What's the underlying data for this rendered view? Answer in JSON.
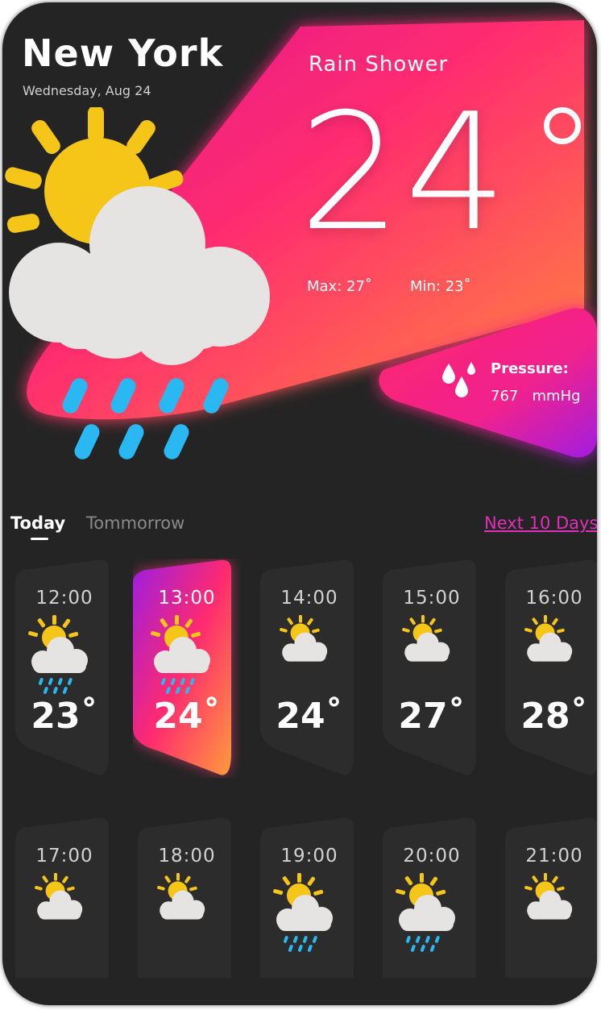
{
  "location": {
    "city": "New York",
    "date": "Wednesday, Aug 24"
  },
  "current": {
    "condition": "Rain Shower",
    "temp": "24",
    "max": "Max: 27˚",
    "min": "Min: 23˚",
    "pressure_label": "Pressure:",
    "pressure_value": "767   mmHg"
  },
  "tabs": {
    "today": "Today",
    "tomorrow": "Tommorrow",
    "next": "Next 10 Days"
  },
  "colors": {
    "background": "#242424",
    "accent_pink": "#ff2d6f",
    "accent_orange": "#ff8a3d",
    "accent_purple": "#a21fe0",
    "link": "#e02fb8"
  },
  "hourly": [
    {
      "time": "12:00",
      "temp": "23˚",
      "icon": "rain-cloud-sun-icon"
    },
    {
      "time": "13:00",
      "temp": "24˚",
      "icon": "rain-cloud-sun-icon"
    },
    {
      "time": "14:00",
      "temp": "24˚",
      "icon": "cloud-sun-icon"
    },
    {
      "time": "15:00",
      "temp": "27˚",
      "icon": "cloud-sun-icon"
    },
    {
      "time": "16:00",
      "temp": "28˚",
      "icon": "cloud-sun-icon"
    },
    {
      "time": "17:00",
      "temp": "",
      "icon": "cloud-sun-icon"
    },
    {
      "time": "18:00",
      "temp": "",
      "icon": "cloud-sun-icon"
    },
    {
      "time": "19:00",
      "temp": "",
      "icon": "rain-cloud-sun-icon"
    },
    {
      "time": "20:00",
      "temp": "",
      "icon": "rain-cloud-sun-icon"
    },
    {
      "time": "21:00",
      "temp": "",
      "icon": "cloud-sun-icon"
    }
  ]
}
